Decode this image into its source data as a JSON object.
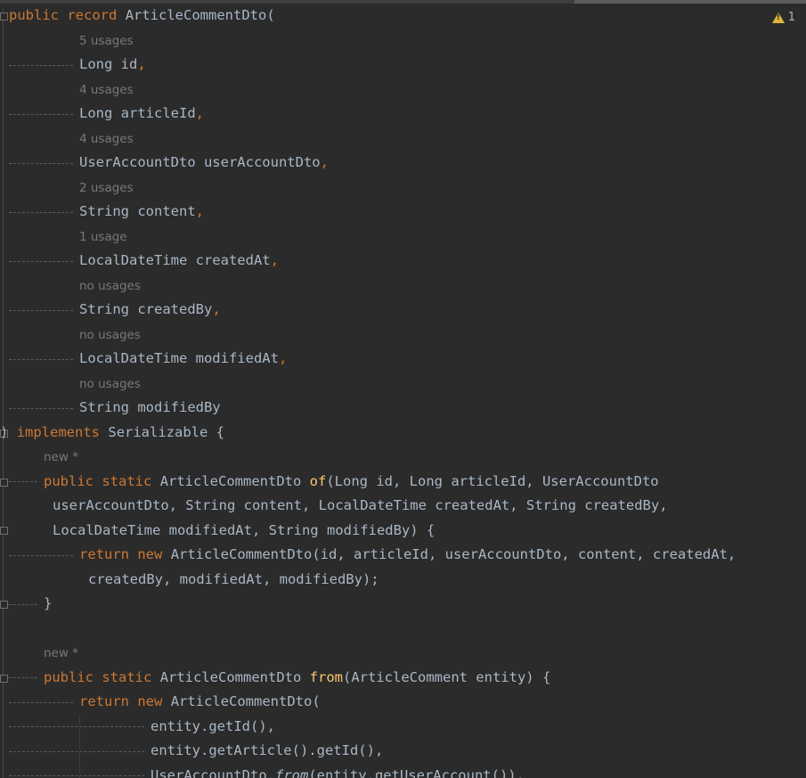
{
  "inspection": {
    "icon": "warning-icon",
    "count": "1"
  },
  "hints": {
    "h1": "5 usages",
    "h2": "4 usages",
    "h3": "4 usages",
    "h4": "2 usages",
    "h5": "1 usage",
    "h6": "no usages",
    "h7": "no usages",
    "h8": "no usages",
    "h9": "new *",
    "h10": "new *"
  },
  "code": {
    "l1_kw1": "public",
    "l1_kw2": "record",
    "l1_rest": "ArticleCommentDto(",
    "f1": "Long id",
    "f2": "Long articleId",
    "f3": "UserAccountDto userAccountDto",
    "f4": "String content",
    "f5": "LocalDateTime createdAt",
    "f6": "String createdBy",
    "f7": "LocalDateTime modifiedAt",
    "f8": "String modifiedBy",
    "comma": ",",
    "impl_paren": ")",
    "impl_kw": "implements",
    "impl_rest": "Serializable {",
    "m1_kw1": "public",
    "m1_kw2": "static",
    "m1_type": "ArticleCommentDto",
    "m1_name": "of",
    "m1_args1": "(Long id, Long articleId, UserAccountDto",
    "m1_args2": "userAccountDto, String content, LocalDateTime createdAt, String createdBy,",
    "m1_args3": "LocalDateTime modifiedAt, String modifiedBy) {",
    "m1_ret_kw": "return",
    "m1_new_kw": "new",
    "m1_ret1": "ArticleCommentDto(id, articleId, userAccountDto, content, createdAt,",
    "m1_ret2": "createdBy, modifiedAt, modifiedBy);",
    "close_brace": "}",
    "m2_kw1": "public",
    "m2_kw2": "static",
    "m2_type": "ArticleCommentDto",
    "m2_name": "from",
    "m2_args": "(ArticleComment entity) {",
    "m2_ret_kw": "return",
    "m2_new_kw": "new",
    "m2_ret": "ArticleCommentDto(",
    "m2_a1": "entity.getId(),",
    "m2_a2": "entity.getArticle().getId(),",
    "m2_a3_cls": "UserAccountDto.",
    "m2_a3_fn": "from",
    "m2_a3_rest": "(entity.getUserAccount()),"
  }
}
